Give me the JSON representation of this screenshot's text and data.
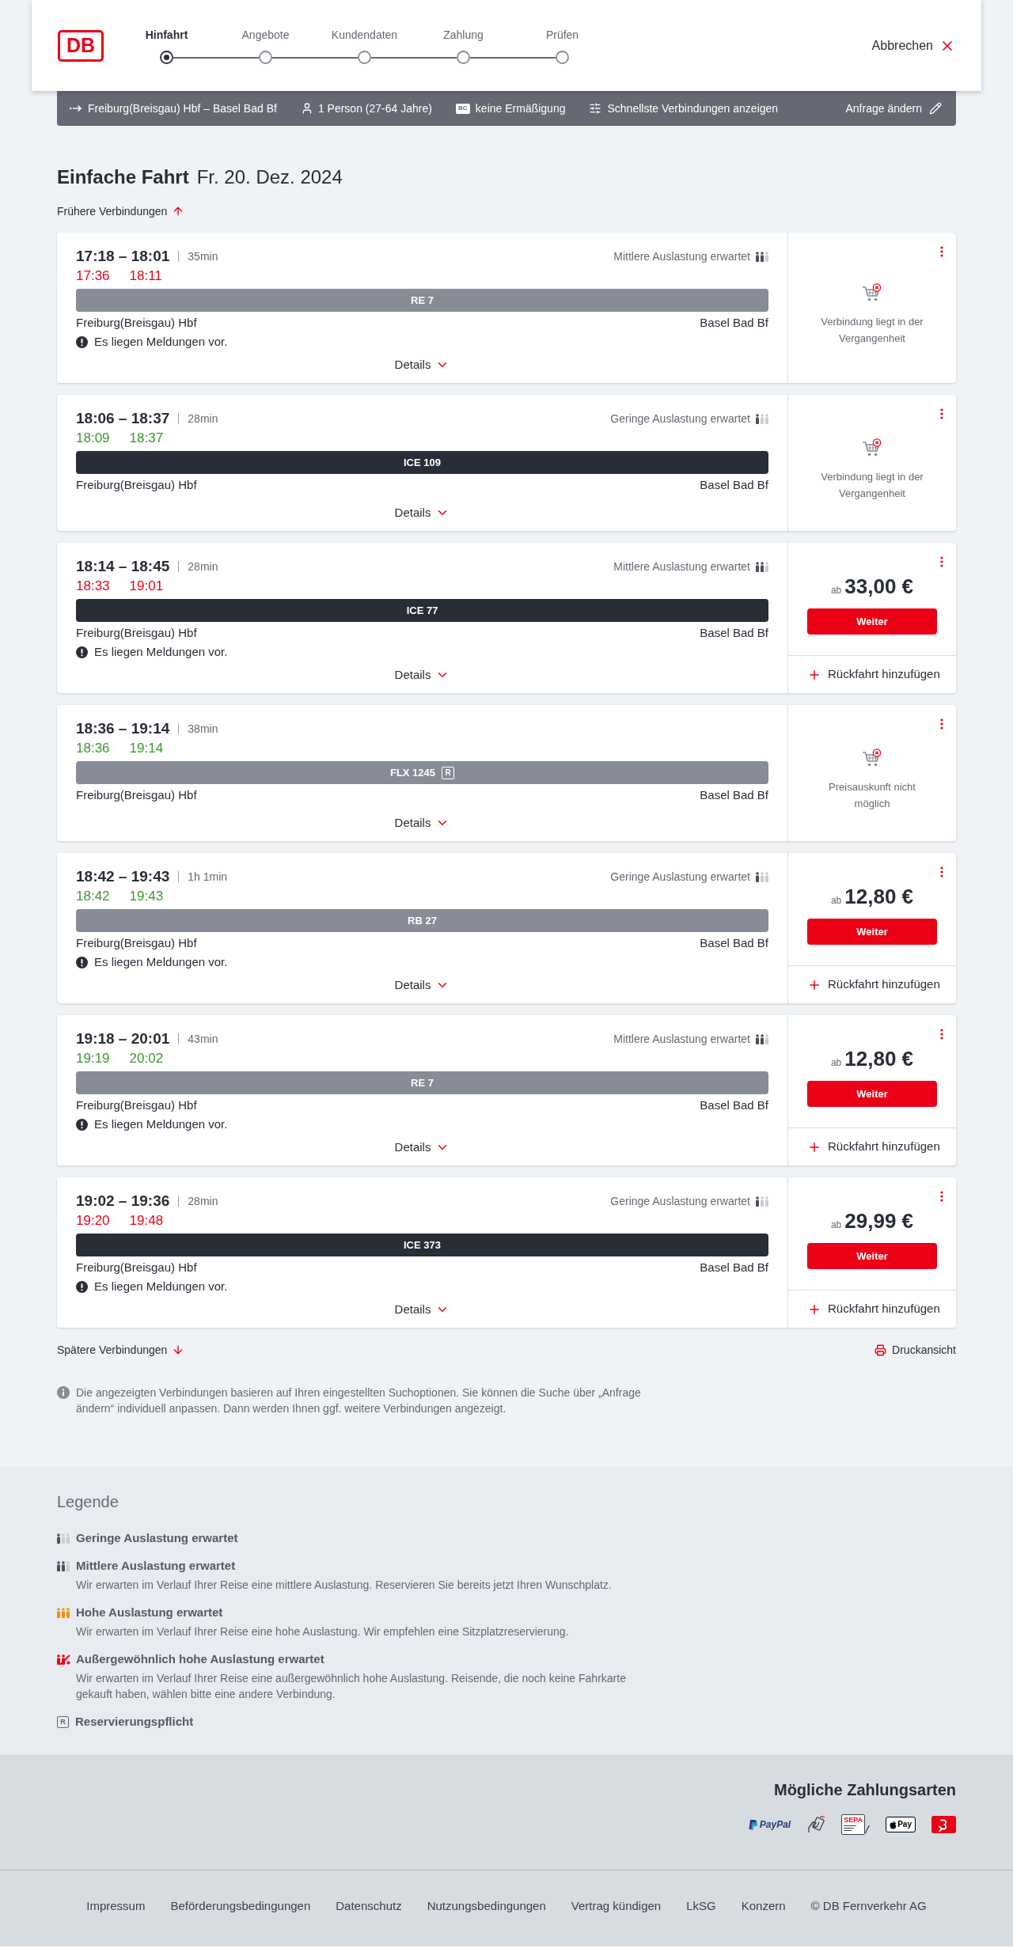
{
  "header": {
    "logo": "DB",
    "steps": [
      {
        "label": "Hinfahrt",
        "selected": true
      },
      {
        "label": "Angebote",
        "selected": false
      },
      {
        "label": "Kundendaten",
        "selected": false
      },
      {
        "label": "Zahlung",
        "selected": false
      },
      {
        "label": "Prüfen",
        "selected": false
      }
    ],
    "cancel": "Abbrechen"
  },
  "search_summary": {
    "route": "Freiburg(Breisgau) Hbf – Basel Bad Bf",
    "passengers": "1 Person (27-64 Jahre)",
    "discount_badge": "BC",
    "discount": "keine Ermäßigung",
    "filter": "Schnellste Verbindungen anzeigen",
    "edit": "Anfrage ändern"
  },
  "title": {
    "heading": "Einfache Fahrt",
    "date": "Fr. 20. Dez. 2024"
  },
  "earlier_link": "Frühere Verbindungen",
  "connections": [
    {
      "times": "17:18 – 18:01",
      "duration": "35min",
      "realtime": {
        "departure": "17:36",
        "arrival": "18:11",
        "delayed": true
      },
      "occupancy": {
        "kind": "medium",
        "label": "Mittlere Auslastung erwartet"
      },
      "train": {
        "label": "RE 7",
        "kind": "regional"
      },
      "from": "Freiburg(Breisgau) Hbf",
      "to": "Basel Bad Bf",
      "notice": "Es liegen Meldungen vor.",
      "details": "Details",
      "offer": {
        "kind": "unavailable",
        "message": "Verbindung liegt in der Vergangenheit"
      }
    },
    {
      "times": "18:06 – 18:37",
      "duration": "28min",
      "realtime": {
        "departure": "18:09",
        "arrival": "18:37",
        "delayed": false
      },
      "occupancy": {
        "kind": "low",
        "label": "Geringe Auslastung erwartet"
      },
      "train": {
        "label": "ICE 109",
        "kind": "long_distance"
      },
      "from": "Freiburg(Breisgau) Hbf",
      "to": "Basel Bad Bf",
      "details": "Details",
      "offer": {
        "kind": "unavailable",
        "message": "Verbindung liegt in der Vergangenheit"
      }
    },
    {
      "times": "18:14 – 18:45",
      "duration": "28min",
      "realtime": {
        "departure": "18:33",
        "arrival": "19:01",
        "delayed": true
      },
      "occupancy": {
        "kind": "medium",
        "label": "Mittlere Auslastung erwartet"
      },
      "train": {
        "label": "ICE 77",
        "kind": "long_distance"
      },
      "from": "Freiburg(Breisgau) Hbf",
      "to": "Basel Bad Bf",
      "notice": "Es liegen Meldungen vor.",
      "details": "Details",
      "offer": {
        "kind": "price",
        "prefix": "ab",
        "price": "33,00 €",
        "button": "Weiter",
        "return_link": "Rückfahrt hinzufügen"
      }
    },
    {
      "times": "18:36 – 19:14",
      "duration": "38min",
      "realtime": {
        "departure": "18:36",
        "arrival": "19:14",
        "delayed": false
      },
      "train": {
        "label": "FLX 1245",
        "kind": "regional",
        "reservation_badge": "R"
      },
      "from": "Freiburg(Breisgau) Hbf",
      "to": "Basel Bad Bf",
      "details": "Details",
      "offer": {
        "kind": "unavailable",
        "message": "Preisauskunft nicht möglich"
      }
    },
    {
      "times": "18:42 – 19:43",
      "duration": "1h 1min",
      "realtime": {
        "departure": "18:42",
        "arrival": "19:43",
        "delayed": false
      },
      "occupancy": {
        "kind": "low",
        "label": "Geringe Auslastung erwartet"
      },
      "train": {
        "label": "RB 27",
        "kind": "regional"
      },
      "from": "Freiburg(Breisgau) Hbf",
      "to": "Basel Bad Bf",
      "notice": "Es liegen Meldungen vor.",
      "details": "Details",
      "offer": {
        "kind": "price",
        "prefix": "ab",
        "price": "12,80 €",
        "button": "Weiter",
        "return_link": "Rückfahrt hinzufügen"
      }
    },
    {
      "times": "19:18 – 20:01",
      "duration": "43min",
      "realtime": {
        "departure": "19:19",
        "arrival": "20:02",
        "delayed": false
      },
      "occupancy": {
        "kind": "medium",
        "label": "Mittlere Auslastung erwartet"
      },
      "train": {
        "label": "RE 7",
        "kind": "regional"
      },
      "from": "Freiburg(Breisgau) Hbf",
      "to": "Basel Bad Bf",
      "notice": "Es liegen Meldungen vor.",
      "details": "Details",
      "offer": {
        "kind": "price",
        "prefix": "ab",
        "price": "12,80 €",
        "button": "Weiter",
        "return_link": "Rückfahrt hinzufügen"
      }
    },
    {
      "times": "19:02 – 19:36",
      "duration": "28min",
      "realtime": {
        "departure": "19:20",
        "arrival": "19:48",
        "delayed": true
      },
      "occupancy": {
        "kind": "low",
        "label": "Geringe Auslastung erwartet"
      },
      "train": {
        "label": "ICE 373",
        "kind": "long_distance"
      },
      "from": "Freiburg(Breisgau) Hbf",
      "to": "Basel Bad Bf",
      "notice": "Es liegen Meldungen vor.",
      "details": "Details",
      "offer": {
        "kind": "price",
        "prefix": "ab",
        "price": "29,99 €",
        "button": "Weiter",
        "return_link": "Rückfahrt hinzufügen"
      }
    }
  ],
  "later_link": "Spätere Verbindungen",
  "print_link": "Druckansicht",
  "info_note": "Die angezeigten Verbindungen basieren auf Ihren eingestellten Suchoptionen. Sie können die Suche über „Anfrage ändern“ individuell anpassen. Dann werden Ihnen ggf. weitere Verbindungen angezeigt.",
  "legend": {
    "title": "Legende",
    "items": [
      {
        "kind": "low",
        "title": "Geringe Auslastung erwartet"
      },
      {
        "kind": "medium",
        "title": "Mittlere Auslastung erwartet",
        "description": "Wir erwarten im Verlauf Ihrer Reise eine mittlere Auslastung. Reservieren Sie bereits jetzt Ihren Wunschplatz."
      },
      {
        "kind": "high",
        "title": "Hohe Auslastung erwartet",
        "description": "Wir erwarten im Verlauf Ihrer Reise eine hohe Auslastung. Wir empfehlen eine Sitzplatzreservierung."
      },
      {
        "kind": "exceptional",
        "title": "Außergewöhnlich hohe Auslastung erwartet",
        "description": "Wir erwarten im Verlauf Ihrer Reise eine außergewöhnlich hohe Auslastung. Reisende, die noch keine Fahrkarte gekauft haben, wählen bitte eine andere Verbindung."
      },
      {
        "kind": "reservation",
        "badge": "R",
        "title": "Reservierungspflicht"
      }
    ]
  },
  "footer": {
    "payment_title": "Mögliche Zahlungsarten",
    "payment_methods": [
      {
        "kind": "paypal",
        "label": "PayPal"
      },
      {
        "kind": "card"
      },
      {
        "kind": "sepa",
        "label": "SEPA"
      },
      {
        "kind": "applepay",
        "label": "Pay"
      },
      {
        "kind": "bonus"
      }
    ],
    "links": [
      "Impressum",
      "Beförderungsbedingungen",
      "Datenschutz",
      "Nutzungsbedingungen",
      "Vertrag kündigen",
      "LkSG",
      "Konzern"
    ],
    "copyright": "© DB Fernverkehr AG"
  }
}
